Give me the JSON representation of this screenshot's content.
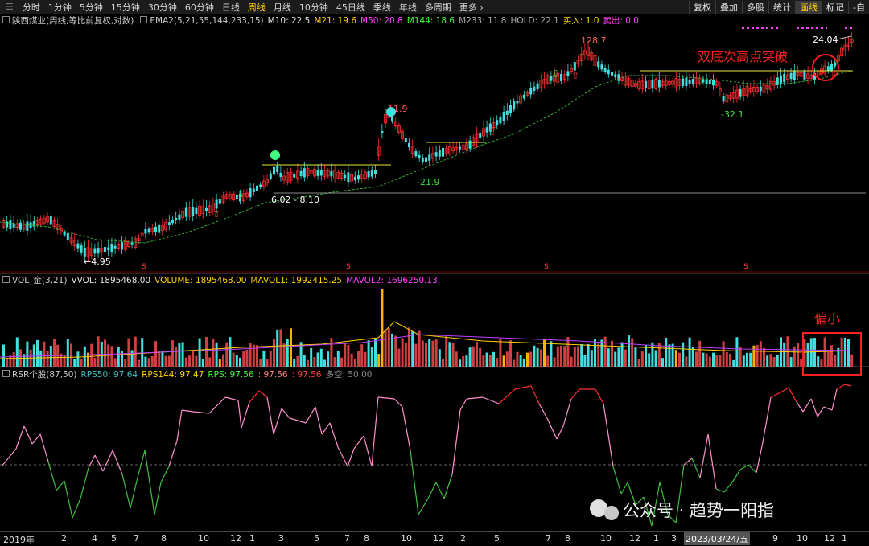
{
  "toolbar": {
    "periods": [
      "分时",
      "1分钟",
      "5分钟",
      "15分钟",
      "30分钟",
      "60分钟",
      "日线",
      "周线",
      "月线",
      "10分钟",
      "45日线",
      "季线",
      "年线",
      "多周期",
      "更多"
    ],
    "active_period": "周线",
    "right_buttons": [
      "复权",
      "叠加",
      "多股",
      "统计",
      "画线",
      "标记",
      "-自"
    ],
    "active_right": "画线"
  },
  "main_panel": {
    "title": "陕西煤业(周线,等比前复权,对数)",
    "indicator": "EMA2(5,21,55,144,233,15)",
    "values": [
      {
        "label": "M10: 22.5",
        "color": "#e6e6e6"
      },
      {
        "label": "M21: 19.6",
        "color": "#ffd000"
      },
      {
        "label": "M50: 20.8",
        "color": "#ff40ff"
      },
      {
        "label": "M144: 18.6",
        "color": "#40ff40"
      },
      {
        "label": "M233: 11.8",
        "color": "#aaaaaa"
      },
      {
        "label": "HOLD: 22.1",
        "color": "#aaaaaa"
      },
      {
        "label": "买入: 1.0",
        "color": "#ffd000"
      },
      {
        "label": "卖出: 0.0",
        "color": "#ff40ff"
      }
    ],
    "annotations": {
      "low_label": "←4.95",
      "range_label": "6.02 - 8.10",
      "peak1_label": "11.9",
      "dip1_label": "-21.9",
      "peak2_label": "128.7",
      "dip2_label": "-32.1",
      "last_label": "24.04",
      "breakout_text": "双底次高点突破",
      "marker_s": "S"
    }
  },
  "vol_panel": {
    "title": "VOL_金(3,21)",
    "values": [
      {
        "label": "VVOL: 1895468.00",
        "color": "#e6e6e6"
      },
      {
        "label": "VOLUME: 1895468.00",
        "color": "#ffd000"
      },
      {
        "label": "MAVOL1: 1992415.25",
        "color": "#ffd000"
      },
      {
        "label": "MAVOL2: 1696250.13",
        "color": "#ff40ff"
      }
    ],
    "note": "偏小"
  },
  "rsr_panel": {
    "title": "RSR个股(87,50)",
    "values": [
      {
        "label": "RPS50: 97.64",
        "color": "#40c0c0"
      },
      {
        "label": "RPS144: 97.47",
        "color": "#ffd000"
      },
      {
        "label": "RPS: 97.56",
        "color": "#40ff40"
      },
      {
        "label": ": 97.56",
        "color": "#ff8080"
      },
      {
        "label": ": 97.56",
        "color": "#ff4040"
      },
      {
        "label": "多空: 50.00",
        "color": "#888888"
      }
    ]
  },
  "x_axis": {
    "labels": [
      "2019年",
      "2",
      "4",
      "5",
      "7",
      "8",
      "10",
      "12",
      "1",
      "3",
      "5",
      "7",
      "8",
      "10",
      "12",
      "2",
      "5",
      "7",
      "8",
      "10",
      "12",
      "1",
      "3",
      "2023/03/24/五",
      "9",
      "10",
      "12",
      "1"
    ],
    "highlight": "2023/03/24/五"
  },
  "watermark": "公众号 · 趋势一阳指",
  "colors": {
    "up": "#ff3030",
    "down": "#40e0e0",
    "volume_big": "#ffb000",
    "note_red": "#ff2020"
  }
}
